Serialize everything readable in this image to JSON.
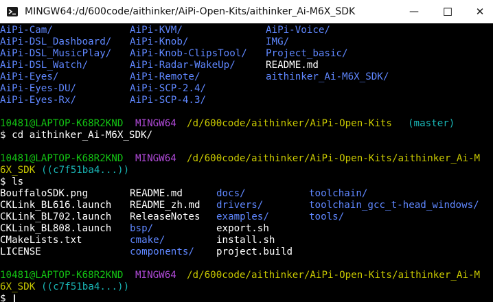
{
  "window": {
    "title": "MINGW64:/d/600code/aithinker/AiPi-Open-Kits/aithinker_Ai-M6X_SDK",
    "minimize_glyph": "—",
    "maximize_glyph": "☐",
    "close_glyph": "✕"
  },
  "colors": {
    "dir": "#5f87ff",
    "file": "#ffffff",
    "user": "#13c413",
    "system": "#b04ad8",
    "path": "#c8c800",
    "branch": "#19b5b5"
  },
  "listing1": {
    "col1": [
      "AiPi-Cam/",
      "AiPi-DSL_Dashboard/",
      "AiPi-DSL_MusicPlay/",
      "AiPi-DSL_Watch/",
      "AiPi-Eyes/",
      "AiPi-Eyes-DU/",
      "AiPi-Eyes-Rx/"
    ],
    "col2": [
      "AiPi-KVM/",
      "AiPi-Knob/",
      "AiPi-Knob-ClipsTool/",
      "AiPi-Radar-WakeUp/",
      "AiPi-Remote/",
      "AiPi-SCP-2.4/",
      "AiPi-SCP-4.3/"
    ],
    "col3": [
      "AiPi-Voice/",
      "IMG/",
      "Project_basic/",
      "README.md",
      "aithinker_Ai-M6X_SDK/"
    ]
  },
  "prompt1": {
    "user": "10481@LAPTOP-K68R2KND",
    "system": "MINGW64",
    "path": "/d/600code/aithinker/AiPi-Open-Kits",
    "branch": "(master)",
    "command": "$ cd aithinker_Ai-M6X_SDK/"
  },
  "prompt2": {
    "user": "10481@LAPTOP-K68R2KND",
    "system": "MINGW64",
    "path_line1": "/d/600code/aithinker/AiPi-Open-Kits/aithinker_Ai-M",
    "path_line2": "6X_SDK",
    "branch": "((c7f51ba4...))",
    "command": "$ ls"
  },
  "listing2": {
    "col1": [
      "BouffaloSDK.png",
      "CKLink_BL616.launch",
      "CKLink_BL702.launch",
      "CKLink_BL808.launch",
      "CMakeLists.txt",
      "LICENSE"
    ],
    "col2": [
      "README.md",
      "README_zh.md",
      "ReleaseNotes",
      "bsp/",
      "cmake/",
      "components/"
    ],
    "col3": [
      "docs/",
      "drivers/",
      "examples/",
      "export.sh",
      "install.sh",
      "project.build"
    ],
    "col4": [
      "toolchain/",
      "toolchain_gcc_t-head_windows/",
      "tools/"
    ]
  },
  "prompt3": {
    "user": "10481@LAPTOP-K68R2KND",
    "system": "MINGW64",
    "path_line1": "/d/600code/aithinker/AiPi-Open-Kits/aithinker_Ai-M",
    "path_line2": "6X_SDK",
    "branch": "((c7f51ba4...))",
    "command": "$"
  }
}
